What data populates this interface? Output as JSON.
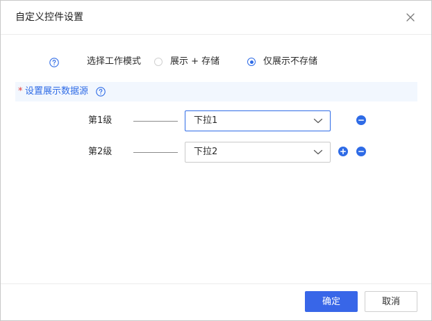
{
  "dialog": {
    "title": "自定义控件设置",
    "close_icon": "close-icon"
  },
  "mode": {
    "label": "选择工作模式",
    "options": [
      {
        "label": "展示 + 存储",
        "checked": false
      },
      {
        "label": "仅展示不存储",
        "checked": true
      }
    ]
  },
  "datasource": {
    "required_mark": "*",
    "label": "设置展示数据源"
  },
  "levels": [
    {
      "label": "第1级",
      "value": "下拉1",
      "add": false,
      "remove": true
    },
    {
      "label": "第2级",
      "value": "下拉2",
      "add": true,
      "remove": true
    }
  ],
  "footer": {
    "confirm_label": "确定",
    "cancel_label": "取消"
  },
  "colors": {
    "accent": "#2e6be6",
    "primary_button": "#3866e8",
    "section_bg": "#f2f7fe",
    "required": "#e53935"
  }
}
